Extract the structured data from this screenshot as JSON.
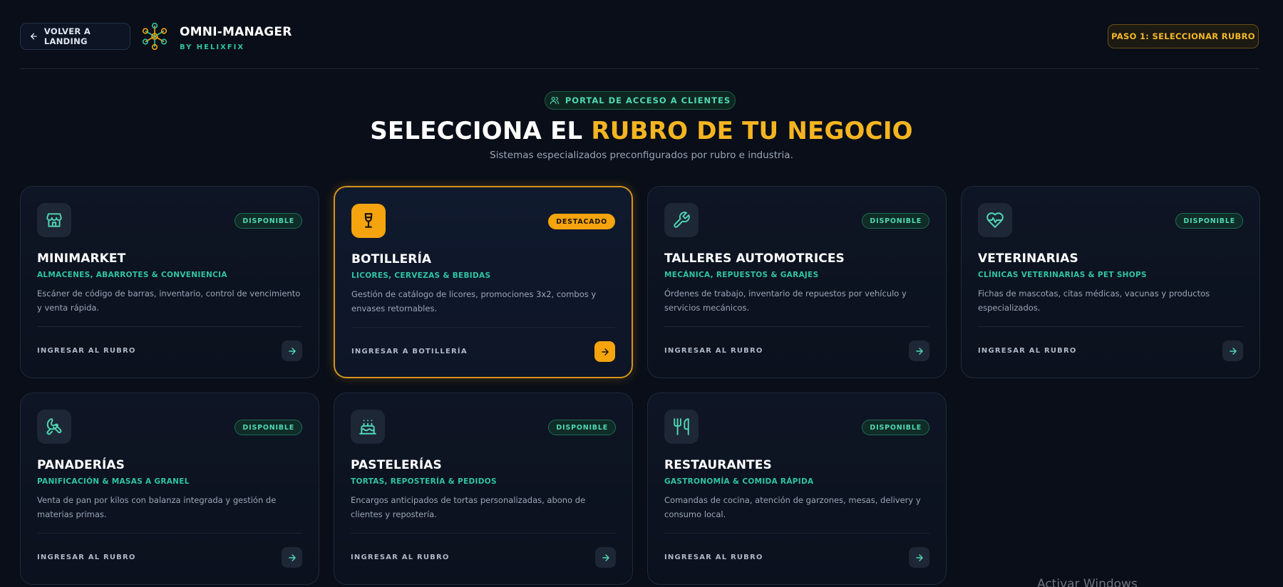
{
  "header": {
    "back_label": "VOLVER A LANDING",
    "brand_name": "OMNI-MANAGER",
    "brand_sub": "BY HELIXFIX",
    "step_label": "PASO 1: SELECCIONAR RUBRO"
  },
  "hero": {
    "pill": "PORTAL DE ACCESO A CLIENTES",
    "title_part1": "SELECCIONA EL ",
    "title_accent": "RUBRO DE TU NEGOCIO",
    "subtitle": "Sistemas especializados preconfigurados por rubro e industria."
  },
  "cards": [
    {
      "icon": "store-icon",
      "badge": "DISPONIBLE",
      "title": "MINIMARKET",
      "subtitle": "ALMACENES, ABARROTES & CONVENIENCIA",
      "desc": "Escáner de código de barras, inventario, control de vencimiento y venta rápida.",
      "cta": "INGRESAR AL RUBRO"
    },
    {
      "icon": "wine-glass-icon",
      "badge": "DESTACADO",
      "title": "BOTILLERÍA",
      "subtitle": "LICORES, CERVEZAS & BEBIDAS",
      "desc": "Gestión de catálogo de licores, promociones 3x2, combos y envases retornables.",
      "cta": "INGRESAR A BOTILLERÍA"
    },
    {
      "icon": "wrench-icon",
      "badge": "DISPONIBLE",
      "title": "TALLERES AUTOMOTRICES",
      "subtitle": "MECÁNICA, REPUESTOS & GARAJES",
      "desc": "Órdenes de trabajo, inventario de repuestos por vehículo y servicios mecánicos.",
      "cta": "INGRESAR AL RUBRO"
    },
    {
      "icon": "heart-pulse-icon",
      "badge": "DISPONIBLE",
      "title": "VETERINARIAS",
      "subtitle": "CLÍNICAS VETERINARIAS & PET SHOPS",
      "desc": "Fichas de mascotas, citas médicas, vacunas y productos especializados.",
      "cta": "INGRESAR AL RUBRO"
    },
    {
      "icon": "croissant-icon",
      "badge": "DISPONIBLE",
      "title": "PANADERÍAS",
      "subtitle": "PANIFICACIÓN & MASAS A GRANEL",
      "desc": "Venta de pan por kilos con balanza integrada y gestión de materias primas.",
      "cta": "INGRESAR AL RUBRO"
    },
    {
      "icon": "cake-icon",
      "badge": "DISPONIBLE",
      "title": "PASTELERÍAS",
      "subtitle": "TORTAS, REPOSTERÍA & PEDIDOS",
      "desc": "Encargos anticipados de tortas personalizadas, abono de clientes y repostería.",
      "cta": "INGRESAR AL RUBRO"
    },
    {
      "icon": "utensils-icon",
      "badge": "DISPONIBLE",
      "title": "RESTAURANTES",
      "subtitle": "GASTRONOMÍA & COMIDA RÁPIDA",
      "desc": "Comandas de cocina, atención de garzones, mesas, delivery y consumo local.",
      "cta": "INGRESAR AL RUBRO"
    }
  ],
  "watermark": "Activar Windows",
  "colors": {
    "background": "#090e18",
    "accent_gold": "#f5a40d",
    "accent_teal": "#2fc4a3"
  }
}
